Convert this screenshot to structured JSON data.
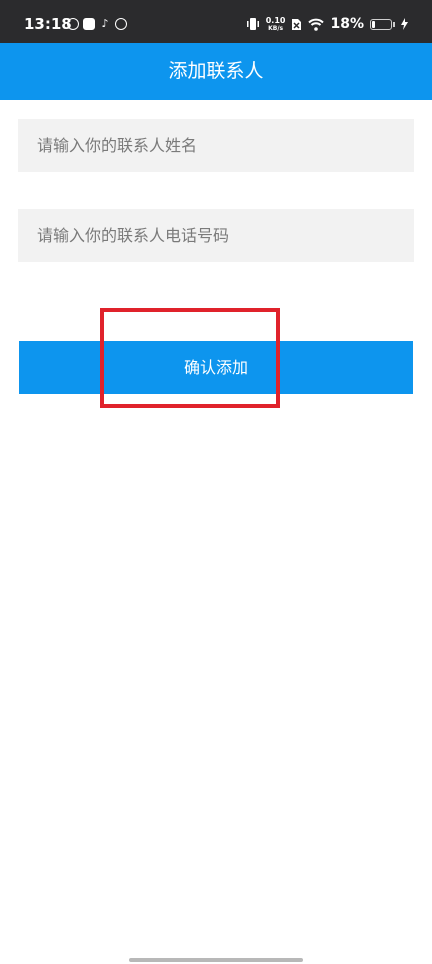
{
  "status_bar": {
    "time": "13:18",
    "net_speed_value": "0.10",
    "net_speed_unit": "KB/s",
    "battery_percent": "18%",
    "battery_level": 0.18,
    "icons": [
      "notification-icon",
      "app-icon",
      "tiktok-icon",
      "sync-icon",
      "vibrate-icon",
      "sim-off-icon",
      "wifi-icon",
      "battery-icon",
      "charging-icon"
    ]
  },
  "header": {
    "title": "添加联系人"
  },
  "form": {
    "name_placeholder": "请输入你的联系人姓名",
    "name_value": "",
    "phone_placeholder": "请输入你的联系人电话号码",
    "phone_value": "",
    "confirm_label": "确认添加"
  },
  "colors": {
    "accent": "#0d95ee",
    "highlight": "#e0222b",
    "status_bar": "#2b2b2d",
    "input_bg": "#f2f2f2"
  }
}
